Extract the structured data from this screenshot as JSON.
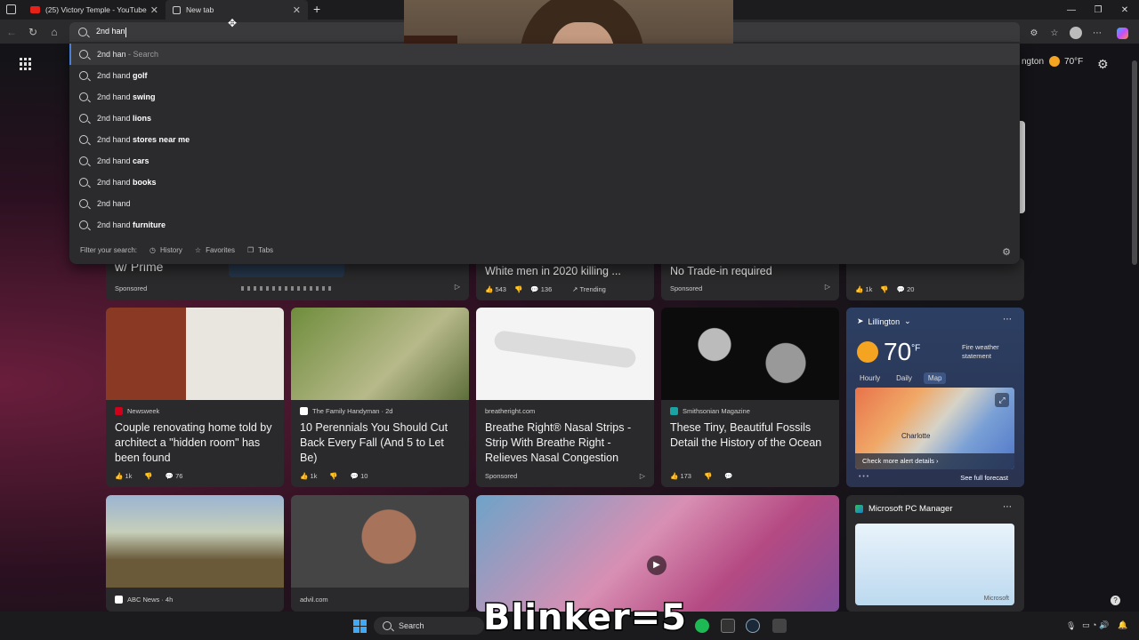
{
  "tabs": [
    {
      "label": "(25) Victory Temple - YouTube",
      "icon": "youtube-icon"
    },
    {
      "label": "New tab",
      "icon": "new-tab-icon"
    }
  ],
  "omnibox": {
    "value": "2nd han"
  },
  "suggestions": [
    {
      "prefix": "2nd han",
      "bold": "",
      "suffix": " - Search"
    },
    {
      "prefix": "2nd hand ",
      "bold": "golf",
      "suffix": ""
    },
    {
      "prefix": "2nd hand ",
      "bold": "swing",
      "suffix": ""
    },
    {
      "prefix": "2nd hand ",
      "bold": "lions",
      "suffix": ""
    },
    {
      "prefix": "2nd hand ",
      "bold": "stores near me",
      "suffix": ""
    },
    {
      "prefix": "2nd hand ",
      "bold": "cars",
      "suffix": ""
    },
    {
      "prefix": "2nd hand ",
      "bold": "books",
      "suffix": ""
    },
    {
      "prefix": "2nd hand",
      "bold": "",
      "suffix": ""
    },
    {
      "prefix": "2nd hand ",
      "bold": "furniture",
      "suffix": ""
    }
  ],
  "filter": {
    "label": "Filter your search:",
    "history": "History",
    "favorites": "Favorites",
    "tabs": "Tabs"
  },
  "header_weather": {
    "city": "ngton",
    "temp": "70°F"
  },
  "row1": [
    {
      "title": "w/ Prime",
      "tag": "Sponsored"
    },
    {
      "title": "White men in 2020 killing ...",
      "likes": "543",
      "comments": "136",
      "trend": "Trending"
    },
    {
      "title": "No Trade-in required",
      "tag": "Sponsored"
    },
    {
      "likes": "1k",
      "comments": "20"
    }
  ],
  "cards": [
    {
      "source": "Newsweek",
      "title": "Couple renovating home told by architect a \"hidden room\" has been found",
      "likes": "1k",
      "comments": "76",
      "logo_color": "#d0021b"
    },
    {
      "source": "The Family Handyman · 2d",
      "title": "10 Perennials You Should Cut Back Every Fall (And 5 to Let Be)",
      "likes": "1k",
      "comments": "10",
      "logo_color": "#ffffff"
    },
    {
      "source": "breatheright.com",
      "title": "Breathe Right® Nasal Strips - Strip With Breathe Right - Relieves Nasal Congestion",
      "tag": "Sponsored"
    },
    {
      "source": "Smithsonian Magazine",
      "title": "These Tiny, Beautiful Fossils Detail the History of the Ocean",
      "likes": "173",
      "logo_color": "#1aa3a3"
    }
  ],
  "weather": {
    "city": "Lillington",
    "temp": "70",
    "unit": "°F",
    "alert": "Fire weather statement",
    "tabs": [
      "Hourly",
      "Daily",
      "Map"
    ],
    "map_city": "Charlotte",
    "alert_link": "Check more alert details",
    "forecast": "See full forecast"
  },
  "row3": [
    {
      "source": "ABC News · 4h"
    },
    {
      "source": "advil.com"
    }
  ],
  "pcmanager": {
    "title": "Microsoft PC Manager",
    "brand": "Microsoft"
  },
  "taskbar": {
    "search": "Search"
  },
  "watermark": "Blinker=5"
}
